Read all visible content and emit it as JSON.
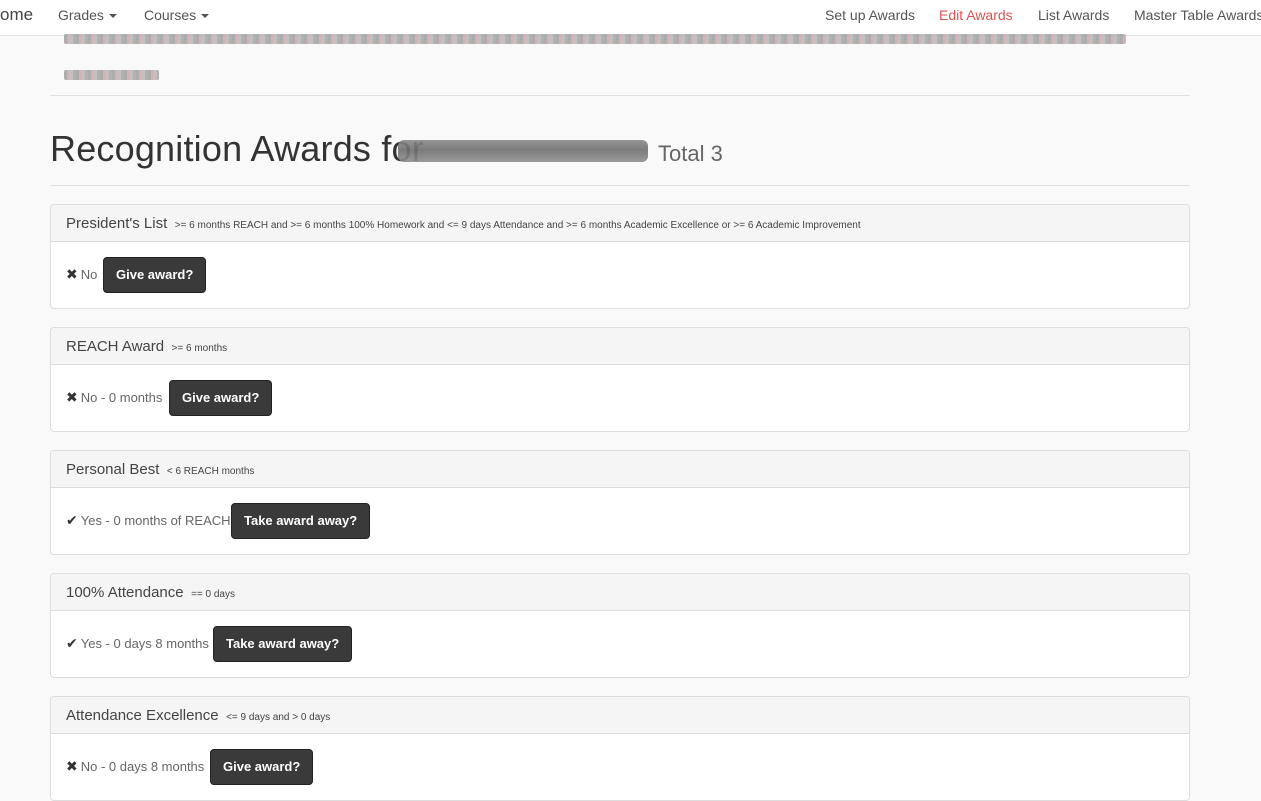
{
  "nav": {
    "home_label": "ome",
    "grades_label": "Grades",
    "courses_label": "Courses",
    "setup_awards_label": "Set up Awards",
    "edit_awards_label": "Edit Awards",
    "list_awards_label": "List Awards",
    "master_table_label": "Master Table Awards",
    "active_color": "#d9534f"
  },
  "header": {
    "title": "Recognition Awards for",
    "total": "Total 3"
  },
  "awards": [
    {
      "name": "President's List",
      "criteria": ">= 6 months REACH and >= 6 months 100% Homework and <= 9 days Attendance and >= 6 months Academic Excellence or >= 6 Academic Improvement",
      "mark": "✖",
      "status": "No",
      "button": "Give award?"
    },
    {
      "name": "REACH Award",
      "criteria": ">= 6 months",
      "mark": "✖",
      "status": "No - 0 months",
      "button": "Give award?"
    },
    {
      "name": "Personal Best",
      "criteria": "< 6 REACH months",
      "mark": "✔",
      "status": "Yes - 0 months of REACH",
      "button": "Take award away?"
    },
    {
      "name": "100% Attendance",
      "criteria": "== 0 days",
      "mark": "✔",
      "status": "Yes - 0 days 8 months",
      "button": "Take award away?"
    },
    {
      "name": "Attendance Excellence",
      "criteria": "<= 9 days and > 0 days",
      "mark": "✖",
      "status": "No - 0 days 8 months",
      "button": "Give award?"
    }
  ]
}
